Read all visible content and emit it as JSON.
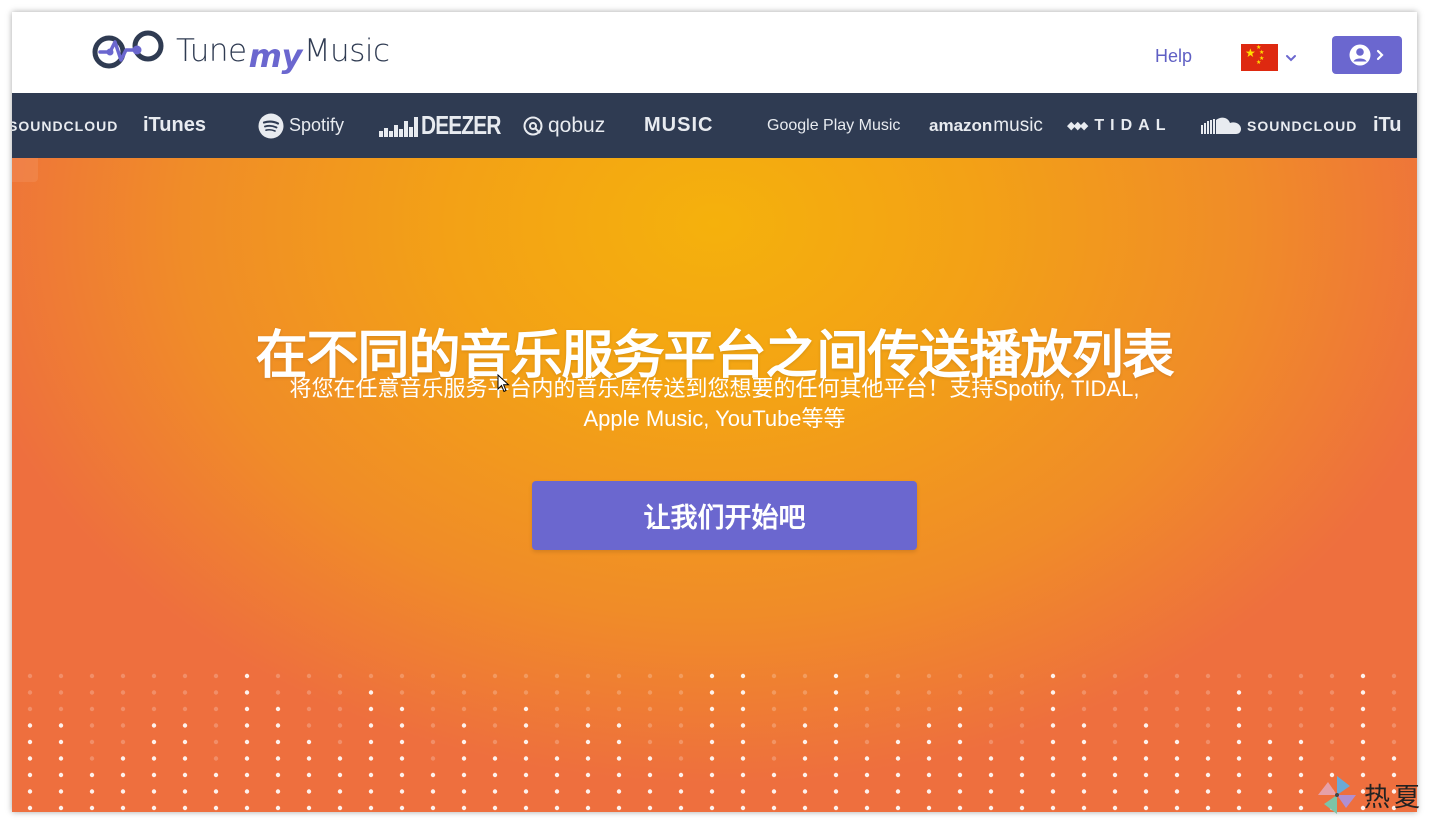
{
  "header": {
    "logo": {
      "text_part1": "Tune",
      "text_part2": "my",
      "text_part3": "Music"
    },
    "help_label": "Help",
    "language": {
      "flag_icon": "china-flag-icon"
    },
    "account_icon": "user-circle-icon"
  },
  "services": [
    "SOUNDCLOUD",
    "iTunes",
    "Spotify",
    "DEEZER",
    "qobuz",
    "MUSIC",
    "Google Play Music",
    "amazon",
    "music",
    "TIDAL",
    "SOUNDCLOUD",
    "iTu"
  ],
  "hero": {
    "title": "在不同的音乐服务平台之间传送播放列表",
    "subtitle": "将您在任意音乐服务平台内的音乐库传送到您想要的任何其他平台！支持Spotify, TIDAL, Apple Music, YouTube等等",
    "cta_label": "让我们开始吧"
  },
  "watermark": {
    "text": "热夏"
  },
  "colors": {
    "primary": "#6b67cf",
    "navy": "#2f3b52",
    "hero_center": "#f5b10c",
    "hero_edge": "#ee6f3e"
  }
}
